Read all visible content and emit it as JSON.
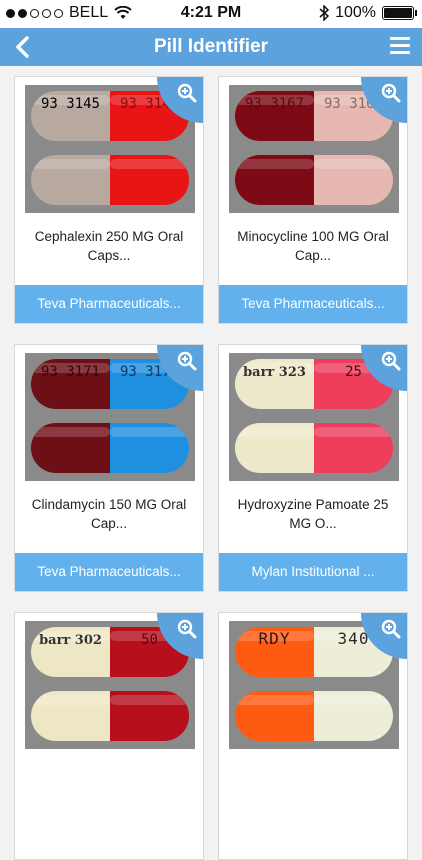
{
  "status": {
    "carrier": "BELL",
    "time": "4:21 PM",
    "battery": "100%"
  },
  "nav": {
    "title": "Pill Identifier",
    "icons": [
      "back-chevron-icon",
      "hamburger-menu-icon"
    ]
  },
  "cards": [
    {
      "name": "Cephalexin 250 MG Oral Caps...",
      "maker": "Teva Pharmaceuticals...",
      "imprint_left": "93 3145",
      "imprint_right": "93 3145",
      "colors": [
        "#b7a99f",
        "#e81416"
      ]
    },
    {
      "name": "Minocycline 100 MG Oral Cap...",
      "maker": "Teva Pharmaceuticals...",
      "imprint_left": "93 3167",
      "imprint_right": "93 3167",
      "colors": [
        "#7d0a14",
        "#e6b8b1"
      ]
    },
    {
      "name": "Clindamycin 150 MG Oral Cap...",
      "maker": "Teva Pharmaceuticals...",
      "imprint_left": "93 3171",
      "imprint_right": "93 3171",
      "colors": [
        "#6e0f16",
        "#1f8fe0"
      ]
    },
    {
      "name": "Hydroxyzine Pamoate 25 MG O...",
      "maker": "Mylan Institutional ...",
      "imprint_left": "barr 323",
      "imprint_right": "25",
      "colors": [
        "#efe9cc",
        "#ee3e5c"
      ]
    },
    {
      "name": "",
      "maker": "",
      "imprint_left": "barr 302",
      "imprint_right": "50",
      "colors": [
        "#eee7c6",
        "#b70f1c"
      ]
    },
    {
      "name": "",
      "maker": "",
      "imprint_left": "RDY",
      "imprint_right": "340",
      "colors": [
        "#ff5a12",
        "#eeeed8"
      ]
    }
  ]
}
